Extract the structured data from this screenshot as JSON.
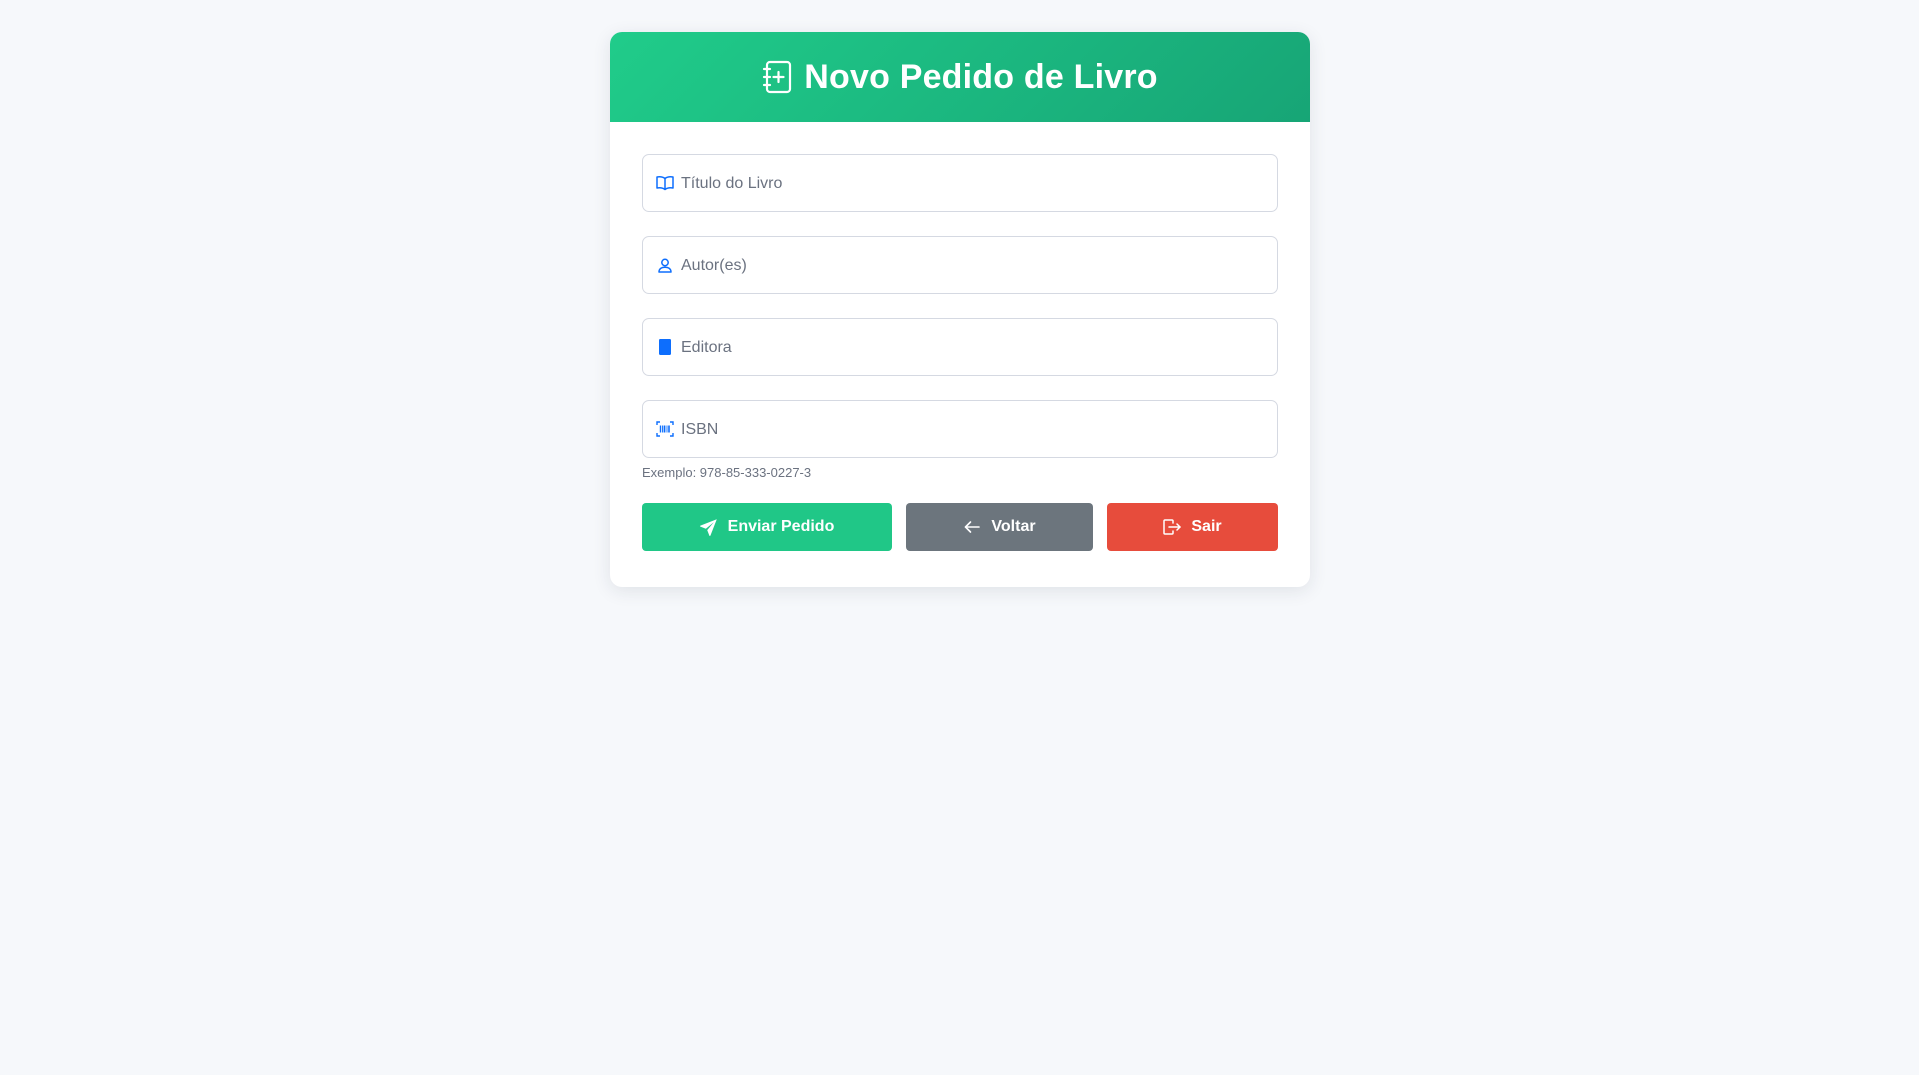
{
  "header": {
    "title": "Novo Pedido de Livro",
    "icon": "journal-plus-icon",
    "gradient_start": "#20cc8a",
    "gradient_end": "#17a576"
  },
  "form": {
    "fields": [
      {
        "icon": "book-open-icon",
        "placeholder": "Título do Livro",
        "value": ""
      },
      {
        "icon": "person-icon",
        "placeholder": "Autor(es)",
        "value": ""
      },
      {
        "icon": "book-fill-icon",
        "placeholder": "Editora",
        "value": ""
      },
      {
        "icon": "barcode-icon",
        "placeholder": "ISBN",
        "value": ""
      }
    ],
    "isbn_hint": "Exemplo: 978-85-333-0227-3",
    "icon_color": "#0d6efd"
  },
  "actions": {
    "send_label": "Enviar Pedido",
    "send_icon": "send-icon",
    "send_color": "#20c787",
    "back_label": "Voltar",
    "back_icon": "arrow-left-icon",
    "back_color": "#6c757d",
    "exit_label": "Sair",
    "exit_icon": "box-arrow-right-icon",
    "exit_color": "#e74c3c"
  },
  "page": {
    "background": "#f6f8fb"
  }
}
